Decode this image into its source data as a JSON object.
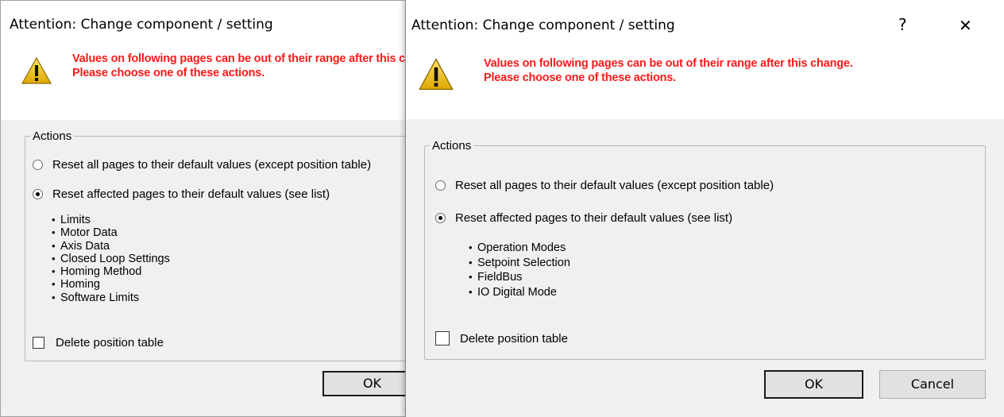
{
  "dialogs": [
    {
      "title": "Attention: Change component / setting",
      "warning_line1": "Values on following pages can be out of their range after this change.",
      "warning_line2": "Please choose one of these actions.",
      "actions_legend": "Actions",
      "option_reset_all": "Reset all pages to their default values (except position table)",
      "option_reset_affected": "Reset affected pages to their default values (see list)",
      "selected_option": "reset_affected",
      "affected_pages": [
        "Limits",
        "Motor Data",
        "Axis Data",
        "Closed Loop Settings",
        "Homing Method",
        "Homing",
        "Software Limits"
      ],
      "delete_position_table": "Delete position table",
      "delete_checked": false,
      "ok_label": "OK"
    },
    {
      "title": "Attention: Change component / setting",
      "help_button": "?",
      "close_button": "✕",
      "warning_line1": "Values on following pages can be out of their range after this change.",
      "warning_line2": "Please choose one of these actions.",
      "actions_legend": "Actions",
      "option_reset_all": "Reset all pages to their default values (except position table)",
      "option_reset_affected": "Reset affected pages to their default values (see list)",
      "selected_option": "reset_affected",
      "affected_pages": [
        "Operation Modes",
        "Setpoint Selection",
        "FieldBus",
        "IO Digital Mode"
      ],
      "delete_position_table": "Delete position table",
      "delete_checked": false,
      "ok_label": "OK",
      "cancel_label": "Cancel"
    }
  ],
  "colors": {
    "warning_text": "#ff1a1a",
    "dialog_bg": "#f0f0f0",
    "header_bg": "#ffffff",
    "warning_icon_fill": "#f5c518"
  },
  "icons": {
    "warning": "warning-triangle-icon"
  }
}
